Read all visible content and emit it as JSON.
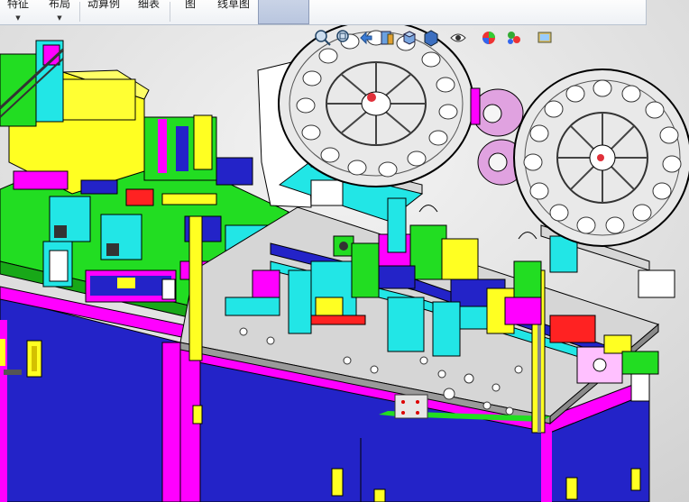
{
  "ribbon": {
    "buttons": [
      {
        "label": "特征",
        "has_dropdown": true
      },
      {
        "label": "布局",
        "has_dropdown": true
      },
      {
        "label": "动算例",
        "has_dropdown": false
      },
      {
        "label": "细表",
        "has_dropdown": false
      },
      {
        "label": "图",
        "has_dropdown": false
      },
      {
        "label": "线草图",
        "has_dropdown": false
      }
    ],
    "dropdown_glyph": "▼"
  },
  "heads_up_toolbar": {
    "icons": [
      "zoom-fit-icon",
      "zoom-area-icon",
      "previous-view-icon",
      "section-view-icon",
      "view-orientation-icon",
      "display-style-icon",
      "hide-show-items-icon",
      "edit-appearance-icon",
      "apply-scene-icon",
      "view-settings-icon"
    ]
  },
  "colors": {
    "frame_magenta": "#ff00ff",
    "cabinet_blue": "#2323c8",
    "plate_gray": "#d6d6d6",
    "plate_green": "#22dd22",
    "yellow": "#ffff22",
    "cyan": "#22e6e6",
    "reel_pink": "#e0a2e0"
  }
}
